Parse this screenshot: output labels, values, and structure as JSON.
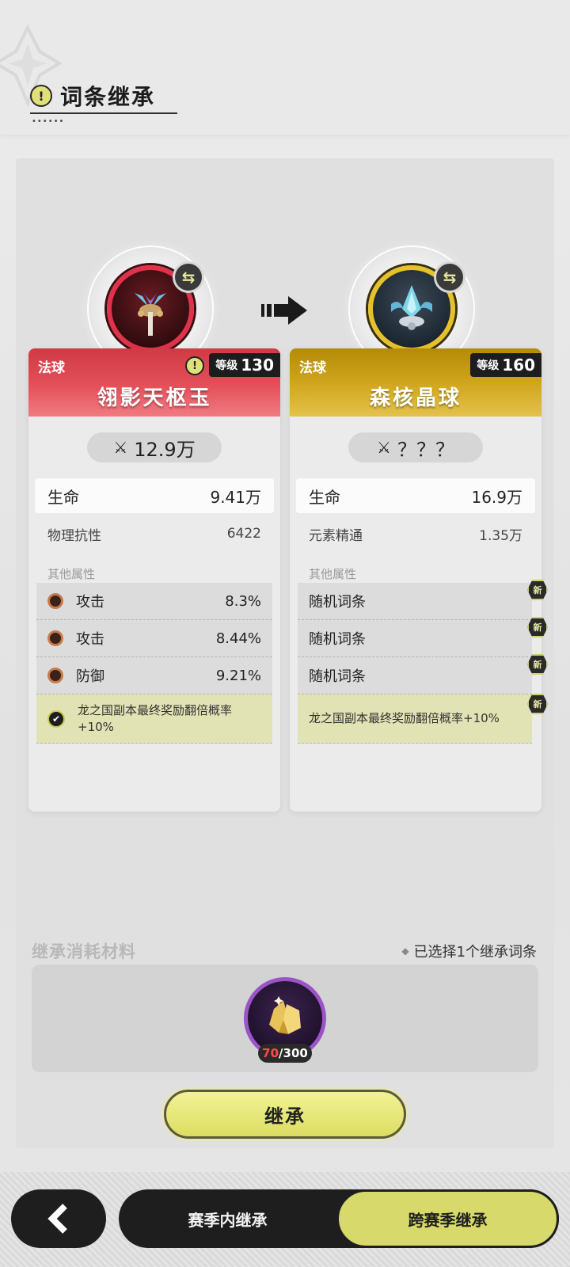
{
  "header": {
    "title": "词条继承"
  },
  "source_item": {
    "type": "法球",
    "level_label": "等级",
    "level": "130",
    "name": "翎影天枢玉",
    "power": "12.9万",
    "main_stat": {
      "name": "生命",
      "value": "9.41万"
    },
    "sub_stat": {
      "name": "物理抗性",
      "value": "6422"
    },
    "other_label": "其他属性",
    "attributes": [
      {
        "name": "攻击",
        "value": "8.3%"
      },
      {
        "name": "攻击",
        "value": "8.44%"
      },
      {
        "name": "防御",
        "value": "9.21%"
      }
    ],
    "special": "龙之国副本最终奖励翻倍概率+10%",
    "colors": {
      "accent": "#e2314a"
    }
  },
  "target_item": {
    "type": "法球",
    "level_label": "等级",
    "level": "160",
    "name": "森核晶球",
    "power": "？？？",
    "main_stat": {
      "name": "生命",
      "value": "16.9万"
    },
    "sub_stat": {
      "name": "元素精通",
      "value": "1.35万"
    },
    "other_label": "其他属性",
    "attributes": [
      {
        "name": "随机词条"
      },
      {
        "name": "随机词条"
      },
      {
        "name": "随机词条"
      }
    ],
    "special": "龙之国副本最终奖励翻倍概率+10%",
    "new_badge": "新",
    "colors": {
      "accent": "#e5c12a"
    }
  },
  "materials": {
    "label": "继承消耗材料",
    "selected_note": "已选择1个继承词条",
    "owned": "70",
    "required": "/300"
  },
  "actions": {
    "inherit_label": "继承"
  },
  "tabs": [
    {
      "label": "赛季内继承",
      "active": false
    },
    {
      "label": "跨赛季继承",
      "active": true
    }
  ]
}
